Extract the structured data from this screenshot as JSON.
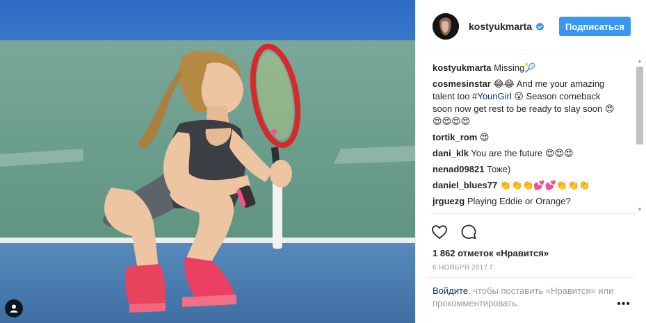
{
  "post": {
    "username": "kostyukmarta",
    "follow_label": "Подписаться",
    "caption": {
      "author": "kostyukmarta",
      "text": " Missing🎾"
    },
    "comments": [
      {
        "author": "cosmesinstar",
        "parts": [
          " 😂😂 And me your amazing talent too ",
          "#YounGirl",
          " 😮 Season comeback soon now get rest to be ready to slay soon 😍😍😍😍😍"
        ]
      },
      {
        "author": "tortik_rom",
        "text": " 😍"
      },
      {
        "author": "dani_klk",
        "text": " You are the future 😍😍😍"
      },
      {
        "author": "nenad09821",
        "text": " Тоже)"
      },
      {
        "author": "daniel_blues77",
        "text": " 👏👏👏💕💕👏👏👏"
      },
      {
        "author": "jrguezg",
        "text": " Playing Eddie or Orange?"
      }
    ],
    "likes": "1 862 отметок «Нравится»",
    "date": "6 НОЯБРЯ 2017 Г.",
    "login_link": "Войдите",
    "login_text": ", чтобы поставить «Нравится» или прокомментировать.",
    "more_label": "•••"
  },
  "colors": {
    "accent": "#3897f0",
    "hashtag": "#003569",
    "muted": "#999999",
    "court_blue": "#4f7fb0",
    "court_green": "#6e9f8e"
  },
  "icons": [
    "user-tag-icon",
    "verified-icon",
    "heart-icon",
    "comment-icon",
    "more-icon"
  ]
}
